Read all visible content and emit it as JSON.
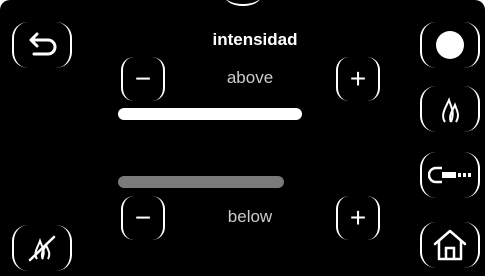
{
  "title": "intensidad",
  "rows": {
    "above": {
      "label": "above",
      "minus_glyph": "−",
      "plus_glyph": "+",
      "bar_color": "#ffffff"
    },
    "below": {
      "label": "below",
      "minus_glyph": "−",
      "plus_glyph": "+",
      "bar_color": "#7a7a7a"
    }
  },
  "icons": {
    "left_top": "back-arrow-icon",
    "left_bottom": "flame-off-icon",
    "right_1": "circle-icon",
    "right_2": "flame-icon",
    "right_3": "plug-icon",
    "right_4": "home-icon"
  },
  "colors": {
    "background": "#000000",
    "foreground": "#ffffff",
    "inactive_bar": "#7a7a7a"
  }
}
